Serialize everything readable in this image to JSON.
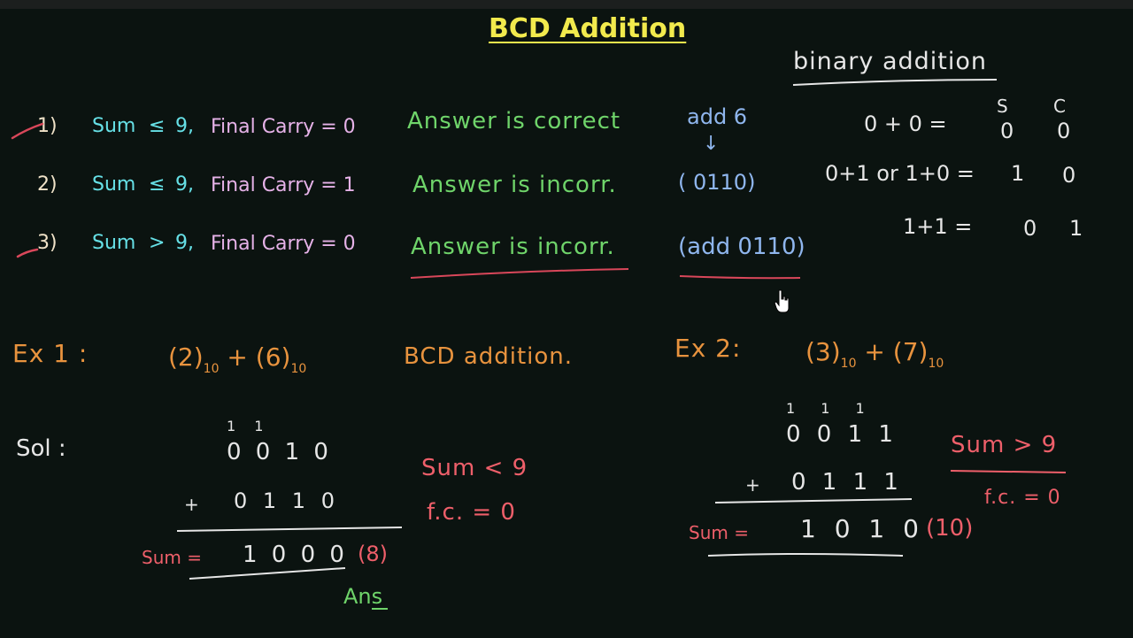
{
  "title": "BCD Addition",
  "rules": [
    {
      "num": "1)",
      "sum_label": "Sum",
      "op": "≤",
      "nine": "9,",
      "carry": "Final Carry = 0",
      "result": "Answer is correct"
    },
    {
      "num": "2)",
      "sum_label": "Sum",
      "op": "≤",
      "nine": "9,",
      "carry": "Final Carry = 1",
      "result": "Answer is incorr."
    },
    {
      "num": "3)",
      "sum_label": "Sum",
      "op": ">",
      "nine": "9,",
      "carry": "Final Carry = 0",
      "result": "Answer is incorr."
    }
  ],
  "add6": {
    "label": "add 6",
    "arrow": "↓",
    "code": "( 0110)",
    "add_code": "(add 0110)"
  },
  "binary": {
    "title": "binary addition",
    "header_s": "S",
    "header_c": "C",
    "rows": [
      {
        "expr": "0 + 0 =",
        "s": "0",
        "c": "0"
      },
      {
        "expr": "0+1 or 1+0 =",
        "s": "1",
        "c": "0"
      },
      {
        "expr": "1+1 =",
        "s": "0",
        "c": "1"
      }
    ]
  },
  "ex1": {
    "label": "Ex 1 :",
    "a": "(2)",
    "a_sub": "10",
    "plus": "+",
    "b": "(6)",
    "b_sub": "10",
    "desc": "BCD addition.",
    "sol": "Sol :",
    "carries": "1 1",
    "top": "0 0 1 0",
    "plus_sign": "+",
    "bottom": "0 1 1 0",
    "sum_label": "Sum =",
    "sum": "1 0 0 0",
    "sum_dec": "(8)",
    "ans": "Ans",
    "note1": "Sum < 9",
    "note2": "f.c. = 0"
  },
  "ex2": {
    "label": "Ex 2:",
    "a": "(3)",
    "a_sub": "10",
    "plus": "+",
    "b": "(7)",
    "b_sub": "10",
    "carries": "1 1 1",
    "top": "0 0 1 1",
    "plus_sign": "+",
    "bottom": "0 1 1 1",
    "sum_label": "Sum =",
    "sum": "1 0 1 0",
    "sum_dec": "(10)",
    "note1": "Sum > 9",
    "note2": "f.c. = 0"
  },
  "colors": {
    "title": "#f2ea4d",
    "cyan": "#66e0e6",
    "pink": "#e6b2e8",
    "green": "#6fd46a",
    "blue": "#8fb6ee",
    "orange": "#e8933e",
    "red": "#ee5f6a"
  }
}
